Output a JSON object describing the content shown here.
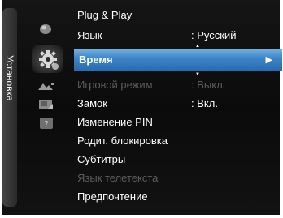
{
  "sidebar": {
    "label": "Установка"
  },
  "menu": {
    "items": [
      {
        "label": "Plug & Play",
        "value": ""
      },
      {
        "label": "Язык",
        "value": ": Русский"
      },
      {
        "label": "Время",
        "value": "",
        "arrow": "▶"
      },
      {
        "label": "Игровой режим",
        "value": ": Выкл."
      },
      {
        "label": "Замок",
        "value": ": Вкл."
      },
      {
        "label": "Изменение PIN",
        "value": ""
      },
      {
        "label": "Родит. блокировка",
        "value": ""
      },
      {
        "label": "Субтитры",
        "value": ""
      },
      {
        "label": "Язык телетекста",
        "value": ""
      },
      {
        "label": "Предпочтение",
        "value": ""
      }
    ]
  },
  "icons": [
    "picture-icon",
    "setup-gear-icon",
    "input-icon",
    "application-icon",
    "support-icon"
  ],
  "colors": {
    "highlight": "#3e86c8",
    "background": "#111111",
    "disabled_text": "#5c5c5c"
  }
}
